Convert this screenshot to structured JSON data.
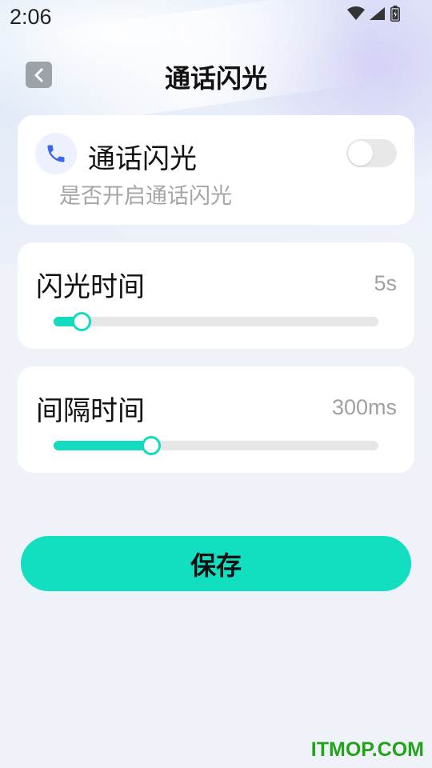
{
  "status_bar": {
    "time": "2:06",
    "icons": [
      "wifi-icon",
      "cellular-signal-icon",
      "battery-icon"
    ]
  },
  "header": {
    "back_icon": "chevron-left-icon",
    "title": "通话闪光"
  },
  "call_flash": {
    "icon": "phone-icon",
    "title": "通话闪光",
    "subtitle": "是否开启通话闪光",
    "enabled": false
  },
  "flash_duration": {
    "label": "闪光时间",
    "value": "5s",
    "slider_fraction": 0.085
  },
  "interval": {
    "label": "间隔时间",
    "value": "300ms",
    "slider_fraction": 0.3
  },
  "save_button": {
    "label": "保存"
  },
  "watermark": "ITMOP.COM",
  "colors": {
    "accent": "#12dfc0",
    "phone_icon": "#3a66f0",
    "watermark": "#22a31a"
  }
}
